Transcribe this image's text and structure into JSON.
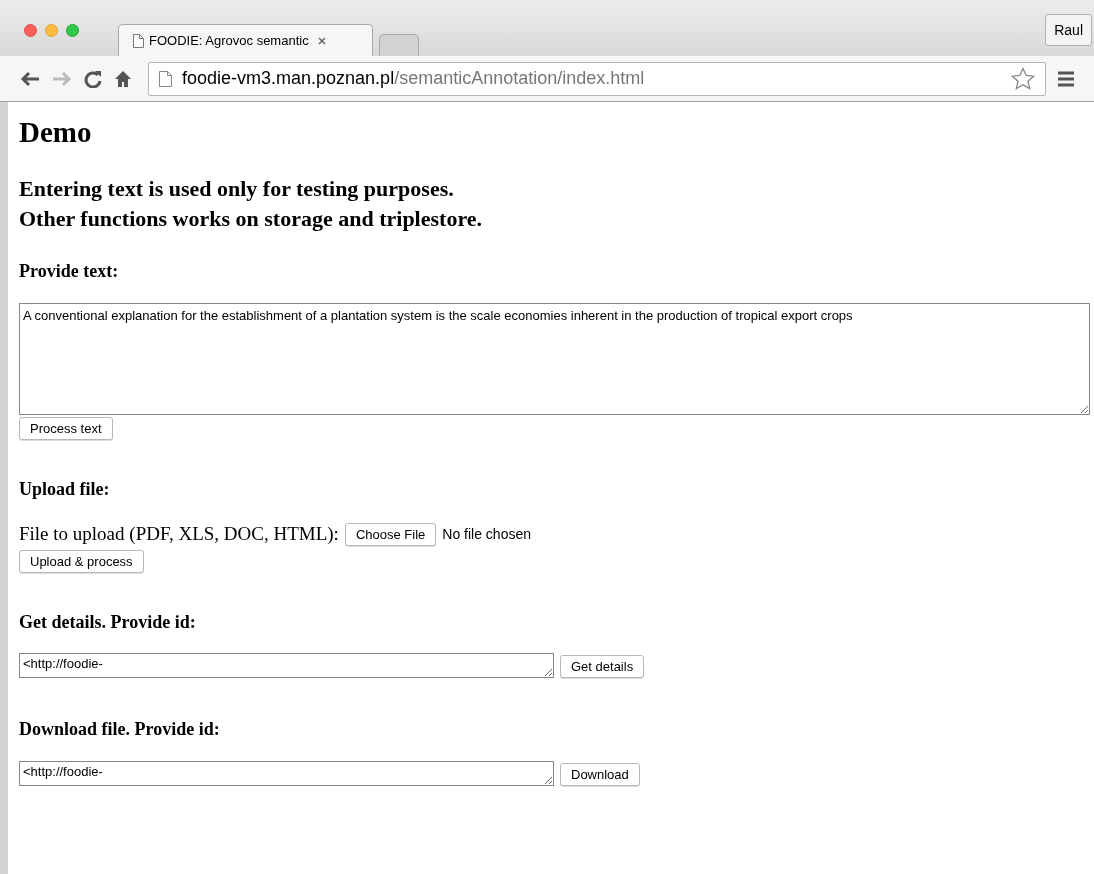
{
  "browser": {
    "tabs": [
      {
        "title": "FOODIE: Agrovoc semantic",
        "selected": true
      }
    ],
    "profile": "Raul",
    "address": {
      "host": "foodie-vm3.man.poznan.pl",
      "path": "/semanticAnnotation/index.html"
    }
  },
  "page": {
    "title": "Demo",
    "notes": [
      "Entering text is used only for testing purposes.",
      "Other functions works on storage and triplestore."
    ],
    "sections": [
      {
        "kind": "text",
        "heading": "Provide text:",
        "value": "A conventional explanation for the establishment of a plantation system is the scale economies inherent in the production of tropical export crops",
        "button": "Process text"
      },
      {
        "kind": "upload",
        "heading": "Upload file:",
        "label": "File to upload (PDF, XLS, DOC, HTML):",
        "choose": "Choose File",
        "status": "No file chosen",
        "button": "Upload & process"
      },
      {
        "kind": "id",
        "heading": "Get details. Provide id:",
        "value": "<http://foodie-",
        "button": "Get details"
      },
      {
        "kind": "id",
        "heading": "Download file. Provide id:",
        "value": "<http://foodie-",
        "button": "Download"
      }
    ]
  }
}
